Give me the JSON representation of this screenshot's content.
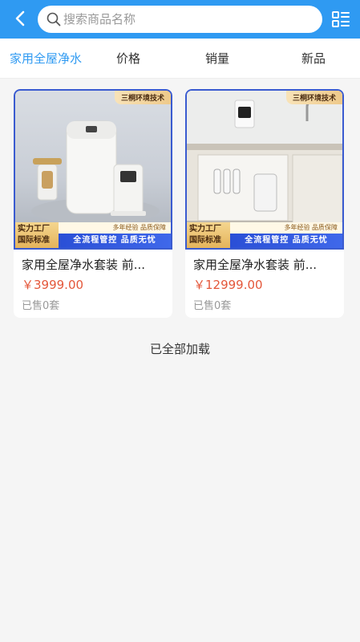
{
  "search": {
    "placeholder": "搜索商品名称"
  },
  "sort_tabs": [
    {
      "label": "家用全屋净水",
      "active": true
    },
    {
      "label": "价格",
      "active": false
    },
    {
      "label": "销量",
      "active": false
    },
    {
      "label": "新品",
      "active": false
    }
  ],
  "products": [
    {
      "title": "家用全屋净水套装 前...",
      "price": "￥3999.00",
      "sold": "已售0套",
      "badge_top": "三桐环境技术",
      "badge_left": [
        "实力工厂",
        "国际标准"
      ],
      "strip_small": "多年经验 品质保障",
      "strip_main": "全流程管控 品质无忧"
    },
    {
      "title": "家用全屋净水套装 前...",
      "price": "￥12999.00",
      "sold": "已售0套",
      "badge_top": "三桐环境技术",
      "badge_left": [
        "实力工厂",
        "国际标准"
      ],
      "strip_small": "多年经验 品质保障",
      "strip_main": "全流程管控 品质无忧"
    }
  ],
  "footer": {
    "loaded_text": "已全部加载"
  },
  "colors": {
    "primary": "#2f9af2",
    "price": "#e4573a",
    "muted": "#999999"
  }
}
